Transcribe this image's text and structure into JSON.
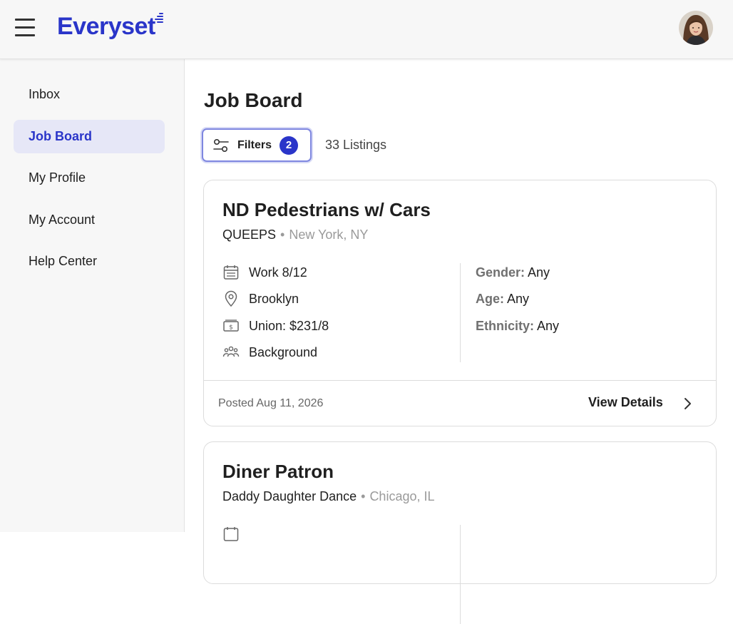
{
  "app": {
    "logo_text": "Everyset"
  },
  "sidebar": {
    "items": [
      {
        "label": "Inbox"
      },
      {
        "label": "Job Board"
      },
      {
        "label": "My Profile"
      },
      {
        "label": "My Account"
      },
      {
        "label": "Help Center"
      }
    ],
    "active": "Job Board"
  },
  "main": {
    "title": "Job Board",
    "filters": {
      "label": "Filters",
      "count": "2"
    },
    "listings_count": "33 Listings"
  },
  "jobs": [
    {
      "title": "ND Pedestrians w/ Cars",
      "production": "QUEEPS",
      "location": "New York, NY",
      "work_date": "Work 8/12",
      "place": "Brooklyn",
      "rate": "Union: $231/8",
      "role_type": "Background",
      "gender_label": "Gender:",
      "gender": "Any",
      "age_label": "Age:",
      "age": "Any",
      "ethnicity_label": "Ethnicity:",
      "ethnicity": "Any",
      "posted": "Posted Aug 11, 2026",
      "view_details": "View Details"
    },
    {
      "title": "Diner Patron",
      "production": "Daddy Daughter Dance",
      "location": "Chicago, IL"
    }
  ],
  "colors": {
    "brand": "#2a35c9",
    "active_nav_bg": "#e6e7f7",
    "muted_text": "#9a9a9a"
  },
  "icons": [
    "hamburger-icon",
    "filter-sliders-icon",
    "calendar-icon",
    "location-pin-icon",
    "money-icon",
    "people-icon",
    "chevron-right-icon"
  ]
}
